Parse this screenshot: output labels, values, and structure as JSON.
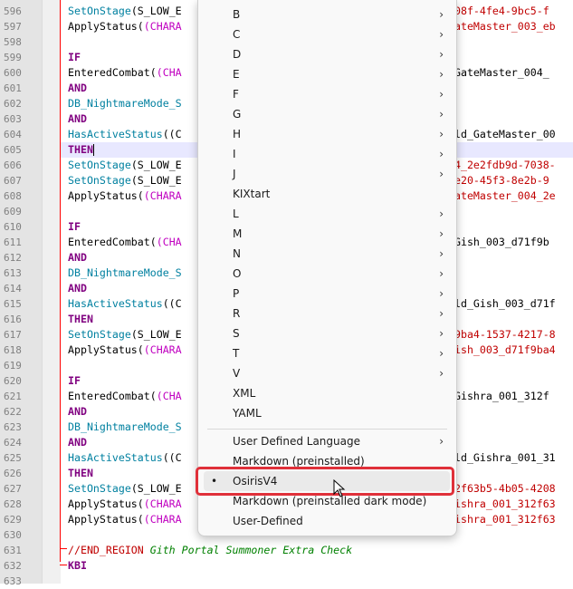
{
  "editor": {
    "lines": [
      {
        "num": "596",
        "code": "SetOnStage(S_LOW_E",
        "tail": "308f-4fe4-9bc5-f",
        "tail_class": "str"
      },
      {
        "num": "597",
        "code": "ApplyStatus((CHARA",
        "tail": "GateMaster_003_eb",
        "tail_class": "str"
      },
      {
        "num": "598",
        "code": "",
        "tail": "",
        "tail_class": ""
      },
      {
        "num": "599",
        "code": "IF",
        "tail": "",
        "tail_class": ""
      },
      {
        "num": "600",
        "code": "EnteredCombat((CHA",
        "tail": "_GateMaster_004_",
        "tail_class": "fn"
      },
      {
        "num": "601",
        "code": "AND",
        "tail": "",
        "tail_class": ""
      },
      {
        "num": "602",
        "code": "DB_NightmareMode_S",
        "tail": "",
        "tail_class": ""
      },
      {
        "num": "603",
        "code": "AND",
        "tail": "",
        "tail_class": ""
      },
      {
        "num": "604",
        "code": "HasActiveStatus((C",
        "tail": "eld_GateMaster_00",
        "tail_class": "fn"
      },
      {
        "num": "605",
        "code": "THEN",
        "tail": "",
        "tail_class": ""
      },
      {
        "num": "606",
        "code": "SetOnStage(S_LOW_E",
        "tail": "04_2e2fdb9d-7038-",
        "tail_class": "str"
      },
      {
        "num": "607",
        "code": "SetOnStage(S_LOW_E",
        "tail": "7e20-45f3-8e2b-9",
        "tail_class": "str"
      },
      {
        "num": "608",
        "code": "ApplyStatus((CHARA",
        "tail": "GateMaster_004_2e",
        "tail_class": "str"
      },
      {
        "num": "609",
        "code": "",
        "tail": "",
        "tail_class": ""
      },
      {
        "num": "610",
        "code": "IF",
        "tail": "",
        "tail_class": ""
      },
      {
        "num": "611",
        "code": "EnteredCombat((CHA",
        "tail": "_Gish_003_d71f9b",
        "tail_class": "fn"
      },
      {
        "num": "612",
        "code": "AND",
        "tail": "",
        "tail_class": ""
      },
      {
        "num": "613",
        "code": "DB_NightmareMode_S",
        "tail": "",
        "tail_class": ""
      },
      {
        "num": "614",
        "code": "AND",
        "tail": "",
        "tail_class": ""
      },
      {
        "num": "615",
        "code": "HasActiveStatus((C",
        "tail": "eld_Gish_003_d71f",
        "tail_class": "fn"
      },
      {
        "num": "616",
        "code": "THEN",
        "tail": "",
        "tail_class": ""
      },
      {
        "num": "617",
        "code": "SetOnStage(S_LOW_E",
        "tail": "f9ba4-1537-4217-8",
        "tail_class": "str"
      },
      {
        "num": "618",
        "code": "ApplyStatus((CHARA",
        "tail": "Gish_003_d71f9ba4",
        "tail_class": "str"
      },
      {
        "num": "619",
        "code": "",
        "tail": "",
        "tail_class": ""
      },
      {
        "num": "620",
        "code": "IF",
        "tail": "",
        "tail_class": ""
      },
      {
        "num": "621",
        "code": "EnteredCombat((CHA",
        "tail": "_Gishra_001_312f",
        "tail_class": "fn"
      },
      {
        "num": "622",
        "code": "AND",
        "tail": "",
        "tail_class": ""
      },
      {
        "num": "623",
        "code": "DB_NightmareMode_S",
        "tail": "",
        "tail_class": ""
      },
      {
        "num": "624",
        "code": "AND",
        "tail": "",
        "tail_class": ""
      },
      {
        "num": "625",
        "code": "HasActiveStatus((C",
        "tail": "eld_Gishra_001_31",
        "tail_class": "fn"
      },
      {
        "num": "626",
        "code": "THEN",
        "tail": "",
        "tail_class": ""
      },
      {
        "num": "627",
        "code": "SetOnStage(S_LOW_E",
        "tail": "12f63b5-4b05-4208",
        "tail_class": "str"
      },
      {
        "num": "628",
        "code": "ApplyStatus((CHARA",
        "tail": "Gishra_001_312f63",
        "tail_class": "str"
      },
      {
        "num": "629",
        "code": "ApplyStatus((CHARA",
        "tail": "Gishra_001_312f63",
        "tail_class": "str"
      },
      {
        "num": "630",
        "code": "",
        "tail": "",
        "tail_class": ""
      },
      {
        "num": "631",
        "code": "//END_REGION Gith Portal Summoner Extra Check",
        "tail": "",
        "tail_class": ""
      },
      {
        "num": "632",
        "code": "KBI",
        "tail": "",
        "tail_class": ""
      },
      {
        "num": "633",
        "code": "",
        "tail": "",
        "tail_class": ""
      }
    ]
  },
  "menu": {
    "items": [
      {
        "label": "B",
        "submenu": true
      },
      {
        "label": "C",
        "submenu": true
      },
      {
        "label": "D",
        "submenu": true
      },
      {
        "label": "E",
        "submenu": true
      },
      {
        "label": "F",
        "submenu": true
      },
      {
        "label": "G",
        "submenu": true
      },
      {
        "label": "H",
        "submenu": true
      },
      {
        "label": "I",
        "submenu": true
      },
      {
        "label": "J",
        "submenu": true
      },
      {
        "label": "KIXtart",
        "submenu": false
      },
      {
        "label": "L",
        "submenu": true
      },
      {
        "label": "M",
        "submenu": true
      },
      {
        "label": "N",
        "submenu": true
      },
      {
        "label": "O",
        "submenu": true
      },
      {
        "label": "P",
        "submenu": true
      },
      {
        "label": "R",
        "submenu": true
      },
      {
        "label": "S",
        "submenu": true
      },
      {
        "label": "T",
        "submenu": true
      },
      {
        "label": "V",
        "submenu": true
      },
      {
        "label": "XML",
        "submenu": false
      },
      {
        "label": "YAML",
        "submenu": false
      }
    ],
    "lower_items": [
      {
        "label": "User Defined Language",
        "submenu": true
      },
      {
        "label": "Markdown (preinstalled)",
        "submenu": false
      },
      {
        "label": "OsirisV4",
        "submenu": false,
        "selected": true
      },
      {
        "label": "Markdown (preinstalled dark mode)",
        "submenu": false
      },
      {
        "label": "User-Defined",
        "submenu": false
      }
    ],
    "chevron": "›",
    "bullet": "•",
    "highlight_color": "#e0303a"
  }
}
